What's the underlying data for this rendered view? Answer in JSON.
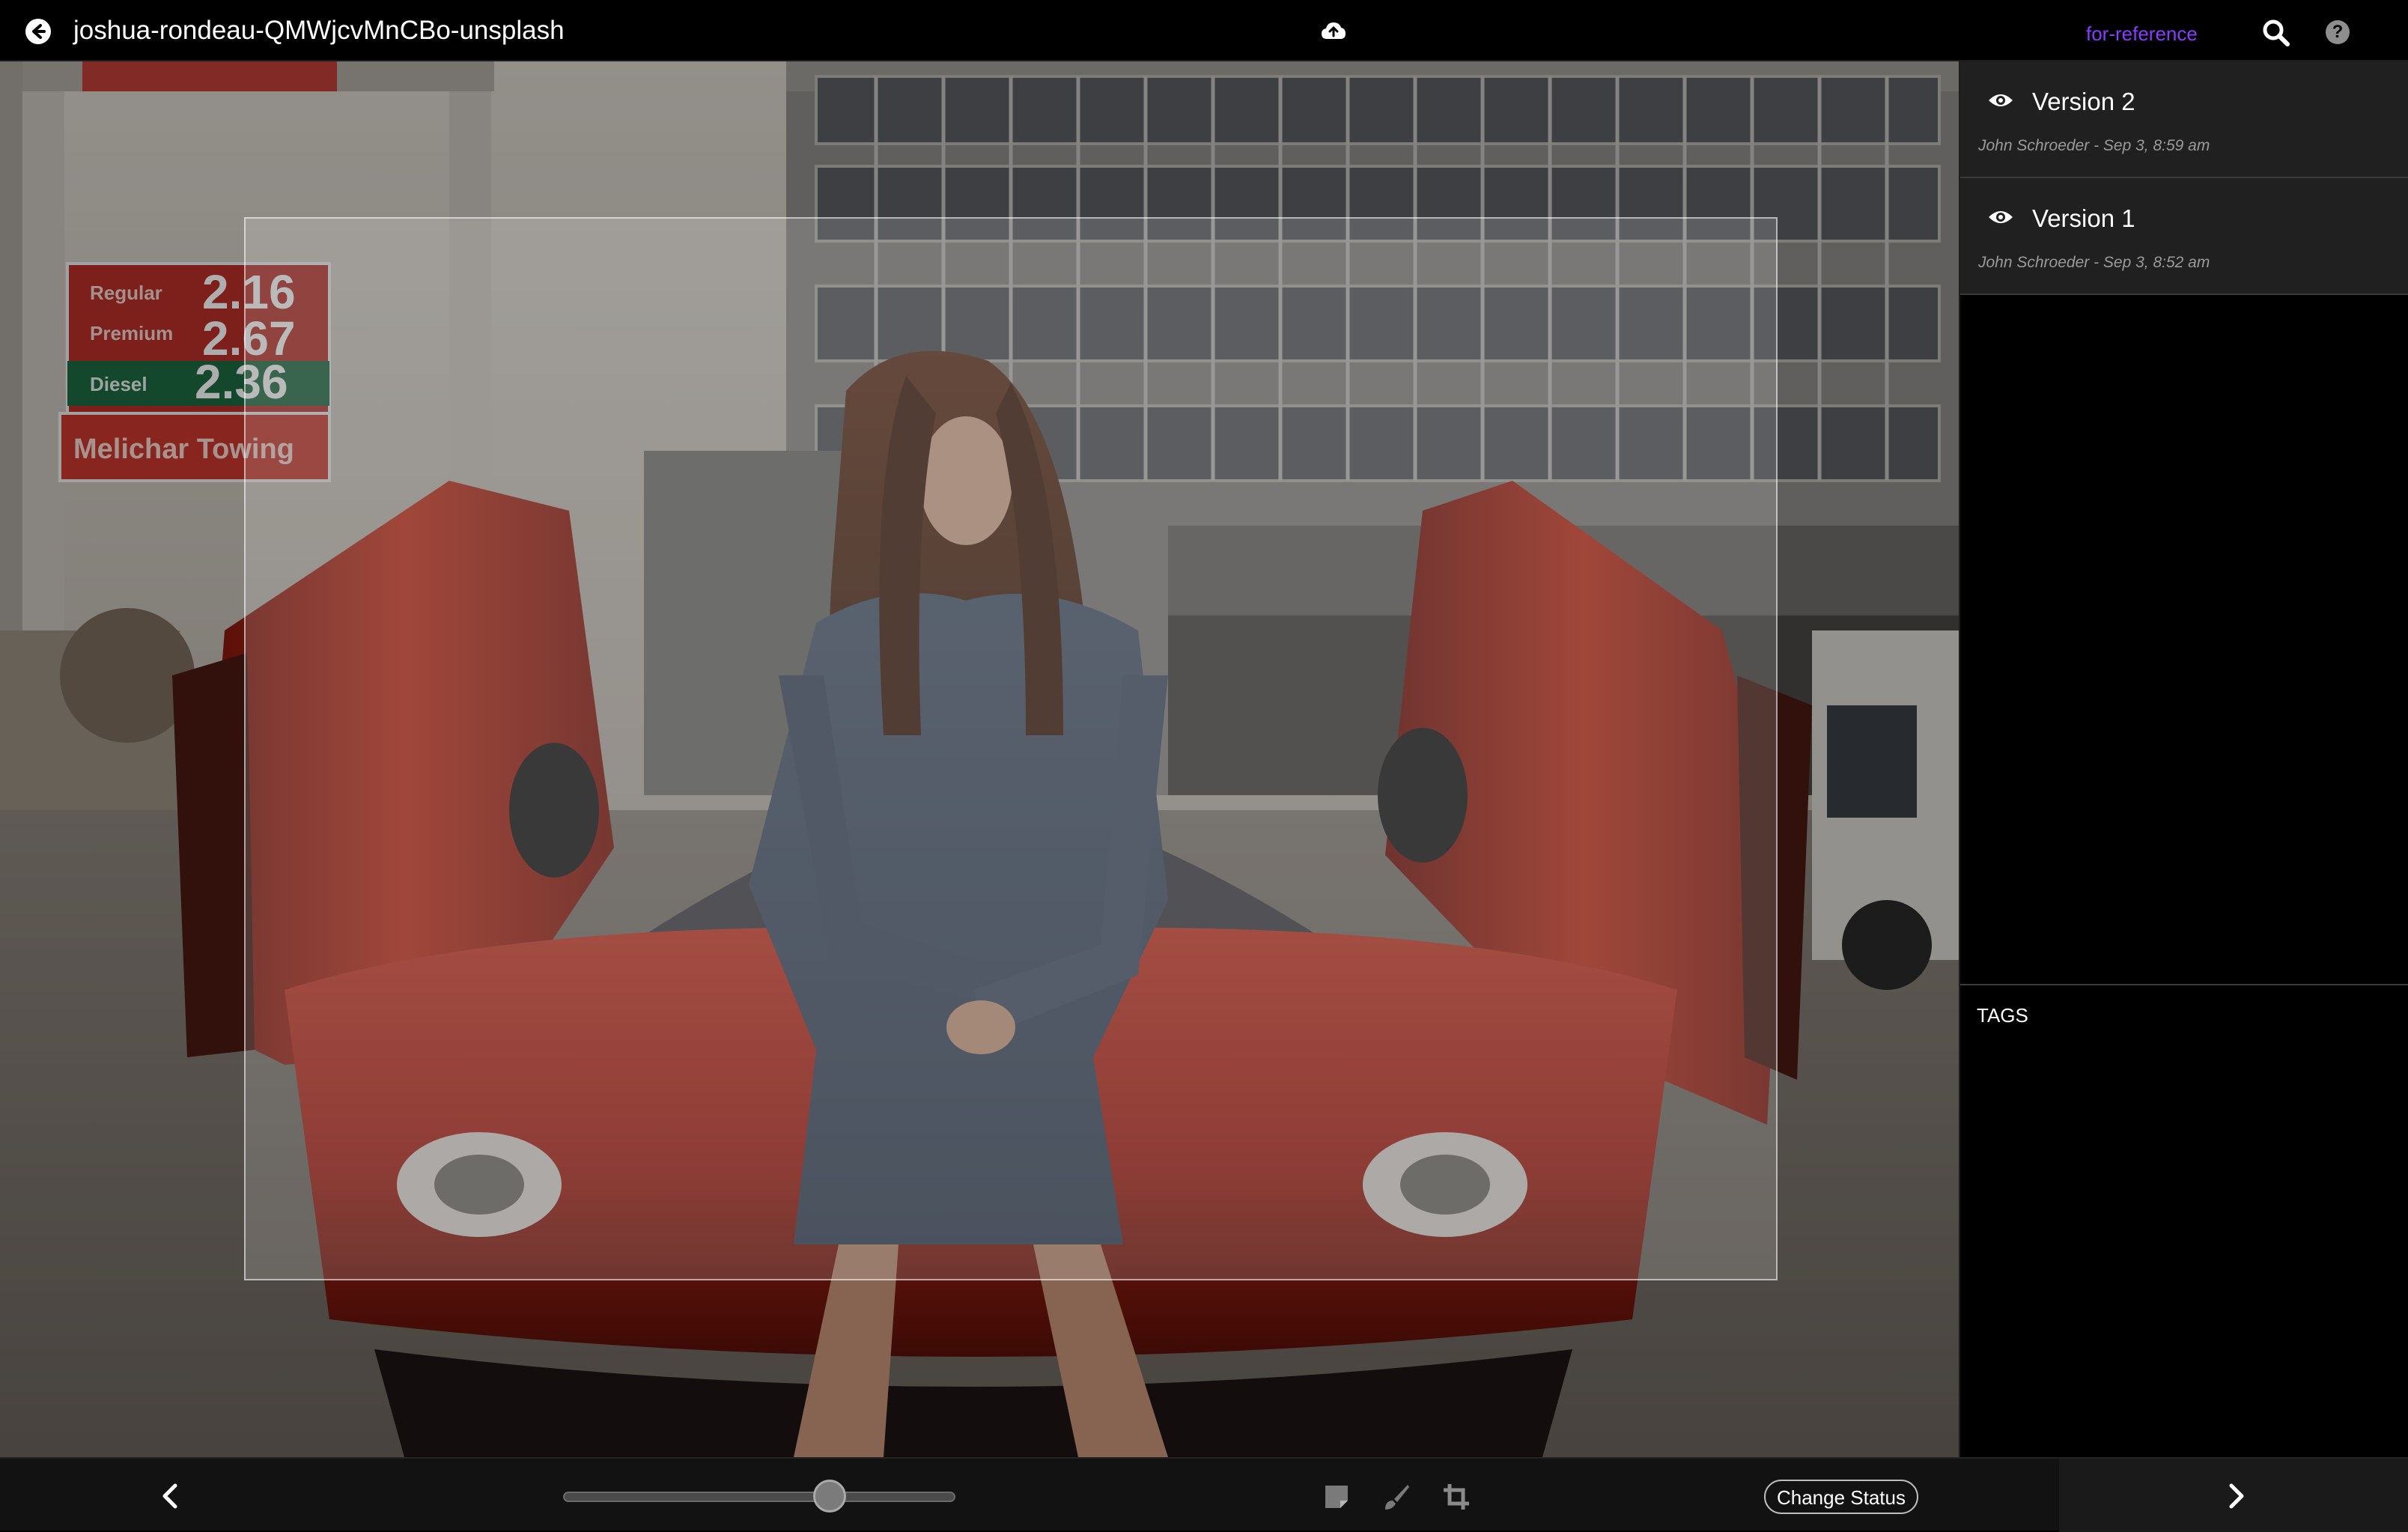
{
  "header": {
    "title": "joshua-rondeau-QMWjcvMnCBo-unsplash",
    "reference_link": "for-reference",
    "back_icon": "arrow-left-circle-icon",
    "upload_icon": "cloud-upload-icon",
    "search_icon": "search-icon",
    "help_icon": "help-circle-icon",
    "help_glyph": "?"
  },
  "colors": {
    "reference_link": "#8b3bff",
    "panel_bg": "#202020",
    "car_red": "#c0281c",
    "dress_denim": "#4a5a72"
  },
  "versions": [
    {
      "label": "Version 2",
      "meta": "John Schroeder - Sep 3, 8:59 am",
      "icon": "eye-icon"
    },
    {
      "label": "Version 1",
      "meta": "John Schroeder - Sep 3, 8:52 am",
      "icon": "eye-icon"
    }
  ],
  "tags": {
    "label": "TAGS"
  },
  "photo": {
    "signs": {
      "price_1": "2.16",
      "price_2": "2.67",
      "price_3": "2.36",
      "grade_1": "Regular",
      "grade_2": "Premium",
      "grade_3": "Diesel",
      "business": "Melichar Towing"
    }
  },
  "toolbar": {
    "zoom_level": 0.68,
    "change_status": "Change Status",
    "prev_icon": "chevron-left-icon",
    "next_icon": "chevron-right-icon",
    "note_icon": "note-icon",
    "brush_icon": "brush-icon",
    "crop_icon": "crop-icon"
  }
}
